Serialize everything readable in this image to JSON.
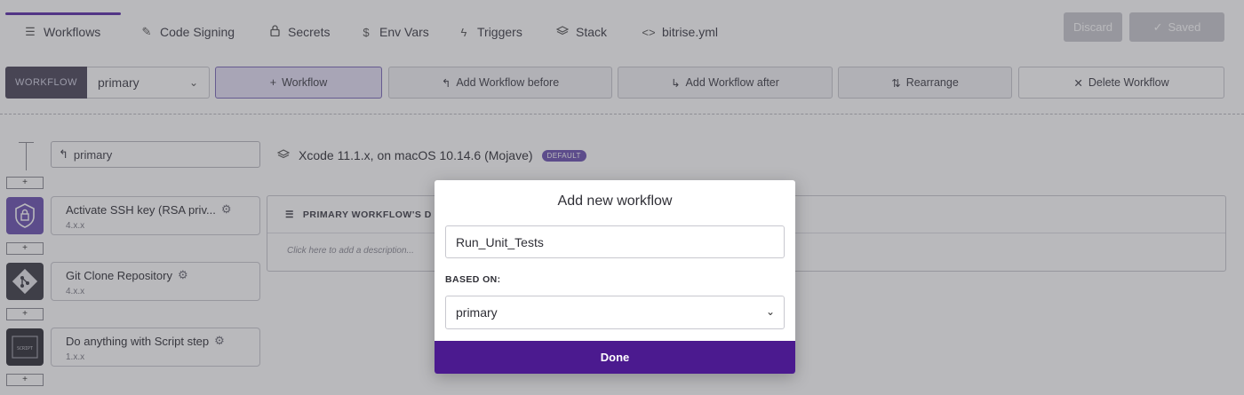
{
  "tabs": [
    {
      "icon": "list-icon",
      "label": "Workflows"
    },
    {
      "icon": "edit-icon",
      "label": "Code Signing"
    },
    {
      "icon": "lock-icon",
      "label": "Secrets"
    },
    {
      "icon": "dollar-icon",
      "label": "Env Vars"
    },
    {
      "icon": "bolt-icon",
      "label": "Triggers"
    },
    {
      "icon": "layers-icon",
      "label": "Stack"
    },
    {
      "icon": "code-icon",
      "label": "bitrise.yml"
    }
  ],
  "header": {
    "discard_label": "Discard",
    "saved_label": "Saved"
  },
  "toolbar": {
    "workflow_label": "WORKFLOW",
    "workflow_selected": "primary",
    "add_workflow": "Workflow",
    "add_before": "Add Workflow before",
    "add_after": "Add Workflow after",
    "rearrange": "Rearrange",
    "delete": "Delete Workflow"
  },
  "workflow": {
    "name": "primary",
    "stack": "Xcode 11.1.x, on macOS 10.14.6 (Mojave)",
    "stack_badge": "DEFAULT",
    "add_step": "+",
    "steps": [
      {
        "title": "Activate SSH key (RSA priv...",
        "version": "4.x.x"
      },
      {
        "title": "Git Clone Repository",
        "version": "4.x.x"
      },
      {
        "title": "Do anything with Script step",
        "version": "1.x.x"
      }
    ],
    "script_icon_text": "SCRIPT"
  },
  "description": {
    "header": "PRIMARY WORKFLOW'S D",
    "placeholder": "Click here to add a description..."
  },
  "modal": {
    "title": "Add new workflow",
    "name_value": "Run_Unit_Tests",
    "based_on_label": "BASED ON:",
    "based_on_value": "primary",
    "done_label": "Done"
  },
  "colors": {
    "accent": "#4b1a8f",
    "overlay": "#46464f",
    "ssh_icon": "#6a4fb0",
    "git_icon": "#3a3a44"
  }
}
